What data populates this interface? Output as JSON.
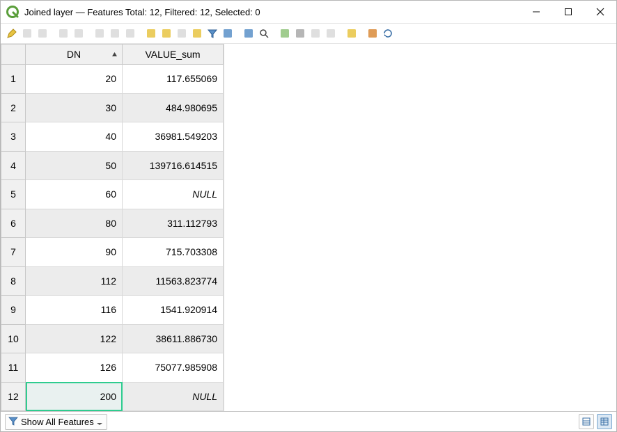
{
  "window": {
    "title": "Joined layer — Features Total: 12, Filtered: 12, Selected: 0"
  },
  "columns": {
    "dn": "DN",
    "value_sum": "VALUE_sum"
  },
  "sort": {
    "column": "DN",
    "dir": "asc"
  },
  "null_label": "NULL",
  "rows": [
    {
      "n": "1",
      "dn": "20",
      "value": "117.655069"
    },
    {
      "n": "2",
      "dn": "30",
      "value": "484.980695"
    },
    {
      "n": "3",
      "dn": "40",
      "value": "36981.549203"
    },
    {
      "n": "4",
      "dn": "50",
      "value": "139716.614515"
    },
    {
      "n": "5",
      "dn": "60",
      "value": null
    },
    {
      "n": "6",
      "dn": "80",
      "value": "311.112793"
    },
    {
      "n": "7",
      "dn": "90",
      "value": "715.703308"
    },
    {
      "n": "8",
      "dn": "112",
      "value": "11563.823774"
    },
    {
      "n": "9",
      "dn": "116",
      "value": "1541.920914"
    },
    {
      "n": "10",
      "dn": "122",
      "value": "38611.886730"
    },
    {
      "n": "11",
      "dn": "126",
      "value": "75077.985908"
    },
    {
      "n": "12",
      "dn": "200",
      "value": null,
      "selected_cell": "dn"
    }
  ],
  "status": {
    "filter_label": "Show All Features"
  },
  "toolbar_icons": [
    "edit-pencil-icon",
    "select-all-icon",
    "save-edits-icon",
    "sep",
    "add-feature-icon",
    "delete-feature-icon",
    "sep",
    "cut-icon",
    "copy-icon",
    "paste-icon",
    "sep",
    "expr-select-icon",
    "select-all-rows-icon",
    "deselect-icon",
    "filter-select-icon",
    "filter-funnel-icon",
    "move-top-icon",
    "sep",
    "pan-to-icon",
    "zoom-to-icon",
    "sep",
    "new-col-icon",
    "delete-col-icon",
    "field-calc-icon",
    "conditional-format-icon",
    "sep",
    "dock-icon",
    "sep",
    "actions-icon",
    "reload-icon"
  ]
}
